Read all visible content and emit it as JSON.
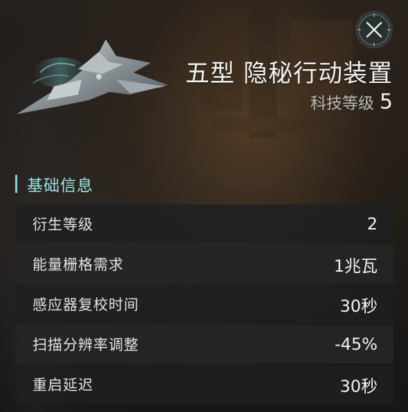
{
  "header": {
    "title": "五型 隐秘行动装置",
    "tech_level_label": "科技等级",
    "tech_level_value": "5"
  },
  "section": {
    "title": "基础信息"
  },
  "attributes": [
    {
      "label": "衍生等级",
      "value": "2"
    },
    {
      "label": "能量栅格需求",
      "value": "1兆瓦"
    },
    {
      "label": "感应器复校时间",
      "value": "30秒"
    },
    {
      "label": "扫描分辨率调整",
      "value": "-45%"
    },
    {
      "label": "重启延迟",
      "value": "30秒"
    }
  ],
  "icons": {
    "close": "close-icon",
    "ship": "ship-image"
  },
  "colors": {
    "accent": "#7fd8dc",
    "row_background": "#202021",
    "text": "#e6e6e6"
  }
}
